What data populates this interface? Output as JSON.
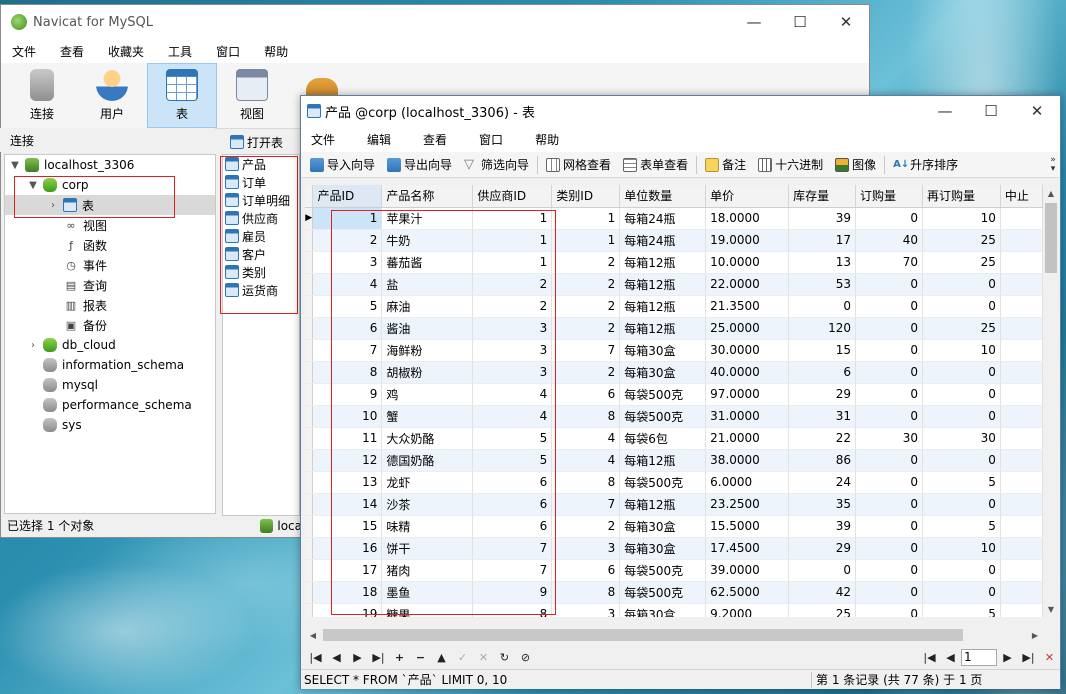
{
  "main_window": {
    "title": "Navicat for MySQL",
    "controls": {
      "minimize": "—",
      "maximize": "☐",
      "close": "✕"
    },
    "menu": [
      "文件",
      "查看",
      "收藏夹",
      "工具",
      "窗口",
      "帮助"
    ],
    "toolbar": [
      {
        "label": "连接",
        "icon": "connection-icon"
      },
      {
        "label": "用户",
        "icon": "user-icon"
      },
      {
        "label": "表",
        "icon": "table-icon",
        "active": true
      },
      {
        "label": "视图",
        "icon": "view-icon"
      }
    ],
    "sidebar_header": "连接",
    "tree": {
      "host": "localhost_3306",
      "corp": "corp",
      "table": "表",
      "view": "视图",
      "function": "函数",
      "event": "事件",
      "query": "查询",
      "report": "报表",
      "backup": "备份",
      "db_cloud": "db_cloud",
      "information_schema": "information_schema",
      "mysql": "mysql",
      "performance_schema": "performance_schema",
      "sys": "sys"
    },
    "status": "已选择 1 个对象",
    "open_table_label": "打开表",
    "object_list": [
      "产品",
      "订单",
      "订单明细",
      "供应商",
      "雇员",
      "客户",
      "类别",
      "运货商"
    ],
    "bottom_conn": "loca"
  },
  "table_window": {
    "title": "产品 @corp (localhost_3306) - 表",
    "controls": {
      "minimize": "—",
      "maximize": "☐",
      "close": "✕"
    },
    "menu": [
      "文件",
      "编辑",
      "查看",
      "窗口",
      "帮助"
    ],
    "toolbar": [
      "导入向导",
      "导出向导",
      "筛选向导",
      "网格查看",
      "表单查看",
      "备注",
      "十六进制",
      "图像",
      "升序排序"
    ],
    "columns": [
      "产品ID",
      "产品名称",
      "供应商ID",
      "类别ID",
      "单位数量",
      "单价",
      "库存量",
      "订购量",
      "再订购量",
      "中止"
    ],
    "rows": [
      [
        "1",
        "苹果汁",
        "1",
        "1",
        "每箱24瓶",
        "18.0000",
        "39",
        "0",
        "10"
      ],
      [
        "2",
        "牛奶",
        "1",
        "1",
        "每箱24瓶",
        "19.0000",
        "17",
        "40",
        "25"
      ],
      [
        "3",
        "蕃茄酱",
        "1",
        "2",
        "每箱12瓶",
        "10.0000",
        "13",
        "70",
        "25"
      ],
      [
        "4",
        "盐",
        "2",
        "2",
        "每箱12瓶",
        "22.0000",
        "53",
        "0",
        "0"
      ],
      [
        "5",
        "麻油",
        "2",
        "2",
        "每箱12瓶",
        "21.3500",
        "0",
        "0",
        "0"
      ],
      [
        "6",
        "酱油",
        "3",
        "2",
        "每箱12瓶",
        "25.0000",
        "120",
        "0",
        "25"
      ],
      [
        "7",
        "海鲜粉",
        "3",
        "7",
        "每箱30盒",
        "30.0000",
        "15",
        "0",
        "10"
      ],
      [
        "8",
        "胡椒粉",
        "3",
        "2",
        "每箱30盒",
        "40.0000",
        "6",
        "0",
        "0"
      ],
      [
        "9",
        "鸡",
        "4",
        "6",
        "每袋500克",
        "97.0000",
        "29",
        "0",
        "0"
      ],
      [
        "10",
        "蟹",
        "4",
        "8",
        "每袋500克",
        "31.0000",
        "31",
        "0",
        "0"
      ],
      [
        "11",
        "大众奶酪",
        "5",
        "4",
        "每袋6包",
        "21.0000",
        "22",
        "30",
        "30"
      ],
      [
        "12",
        "德国奶酪",
        "5",
        "4",
        "每箱12瓶",
        "38.0000",
        "86",
        "0",
        "0"
      ],
      [
        "13",
        "龙虾",
        "6",
        "8",
        "每袋500克",
        "6.0000",
        "24",
        "0",
        "5"
      ],
      [
        "14",
        "沙茶",
        "6",
        "7",
        "每箱12瓶",
        "23.2500",
        "35",
        "0",
        "0"
      ],
      [
        "15",
        "味精",
        "6",
        "2",
        "每箱30盒",
        "15.5000",
        "39",
        "0",
        "5"
      ],
      [
        "16",
        "饼干",
        "7",
        "3",
        "每箱30盒",
        "17.4500",
        "29",
        "0",
        "10"
      ],
      [
        "17",
        "猪肉",
        "7",
        "6",
        "每袋500克",
        "39.0000",
        "0",
        "0",
        "0"
      ],
      [
        "18",
        "墨鱼",
        "9",
        "8",
        "每袋500克",
        "62.5000",
        "42",
        "0",
        "0"
      ],
      [
        "19",
        "糖果",
        "8",
        "3",
        "每箱30盒",
        "9.2000",
        "25",
        "0",
        "5"
      ]
    ],
    "page": "1",
    "sql": "SELECT * FROM `产品` LIMIT 0, 10",
    "record_info": "第 1 条记录 (共 77 条) 于 1 页"
  }
}
